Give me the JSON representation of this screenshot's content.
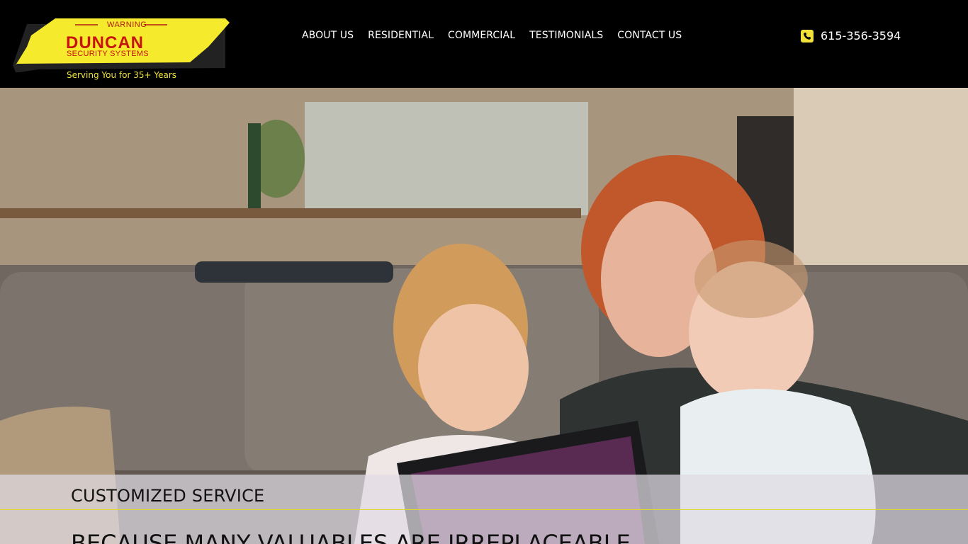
{
  "header": {
    "logo": {
      "warning": "WARNING",
      "name": "DUNCAN",
      "subtitle": "SECURITY SYSTEMS"
    },
    "tagline": "Serving You for 35+ Years",
    "nav": [
      {
        "label": "ABOUT US"
      },
      {
        "label": "RESIDENTIAL"
      },
      {
        "label": "COMMERCIAL"
      },
      {
        "label": "TESTIMONIALS"
      },
      {
        "label": "CONTACT US"
      }
    ],
    "phone": {
      "icon": "phone-icon",
      "number": "615-356-3594"
    }
  },
  "hero": {
    "image": "family-on-couch-with-tablet",
    "caption_title": "CUSTOMIZED SERVICE",
    "caption_heading": "BECAUSE MANY VALUABLES ARE IRREPLACEABLE"
  },
  "colors": {
    "header_bg": "#000000",
    "accent_yellow": "#f0e23a",
    "logo_red": "#c8140e",
    "nav_text": "#ffffff"
  }
}
